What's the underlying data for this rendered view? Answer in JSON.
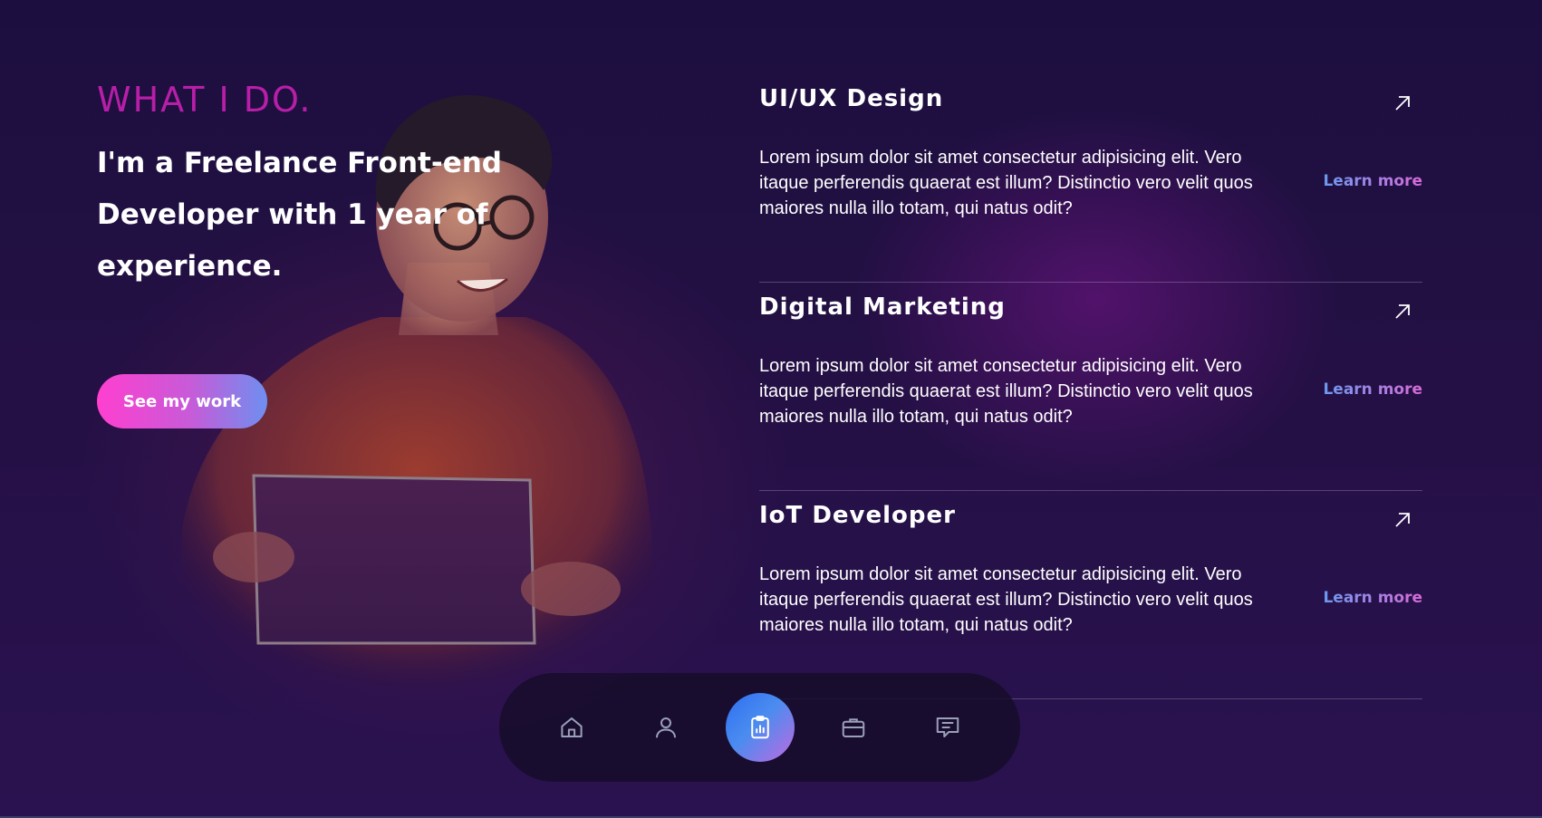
{
  "hero": {
    "kicker": "WHAT I DO.",
    "headline": "I'm a Freelance Front-end Developer with 1 year of experience.",
    "cta_label": "See my work"
  },
  "services": [
    {
      "title": "UI/UX Design",
      "description": "Lorem ipsum dolor sit amet consectetur adipisicing elit. Vero itaque perferendis quaerat est illum? Distinctio vero velit quos maiores nulla illo totam, qui natus odit?",
      "link_label": "Learn more",
      "icon": "arrow-up-right-icon"
    },
    {
      "title": "Digital Marketing",
      "description": "Lorem ipsum dolor sit amet consectetur adipisicing elit. Vero itaque perferendis quaerat est illum? Distinctio vero velit quos maiores nulla illo totam, qui natus odit?",
      "link_label": "Learn more",
      "icon": "arrow-up-right-icon"
    },
    {
      "title": "IoT Developer",
      "description": "Lorem ipsum dolor sit amet consectetur adipisicing elit. Vero itaque perferendis quaerat est illum? Distinctio vero velit quos maiores nulla illo totam, qui natus odit?",
      "link_label": "Learn more",
      "icon": "arrow-up-right-icon"
    }
  ],
  "nav": {
    "items": [
      {
        "icon": "home-icon",
        "active": false
      },
      {
        "icon": "user-icon",
        "active": false
      },
      {
        "icon": "clipboard-chart-icon",
        "active": true
      },
      {
        "icon": "briefcase-icon",
        "active": false
      },
      {
        "icon": "message-icon",
        "active": false
      }
    ]
  },
  "colors": {
    "accent_magenta": "#b81ea8",
    "gradient_pink": "#ff3fd0",
    "gradient_blue": "#6e8ff0",
    "background": "#1c0f3f"
  }
}
